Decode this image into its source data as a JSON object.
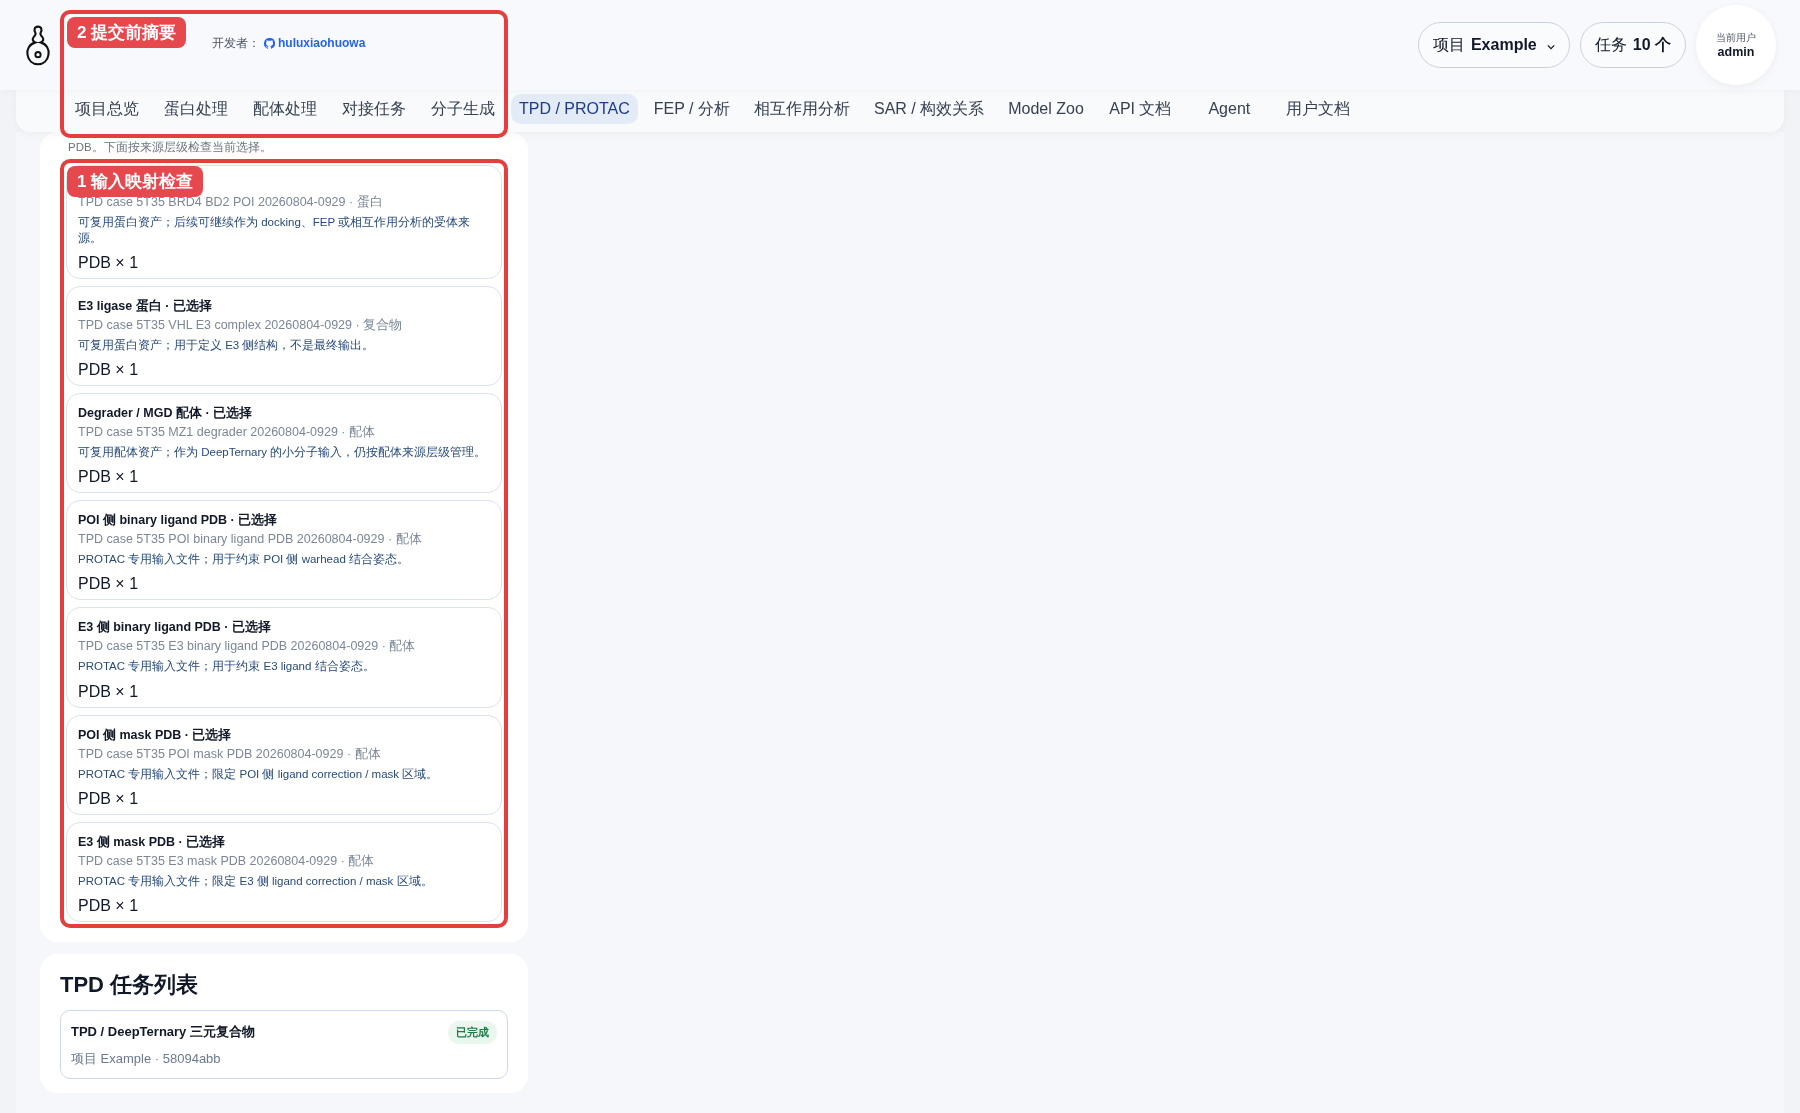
{
  "header": {
    "developer_label": "开发者：",
    "developer_link": "huluxiaohuowa",
    "project": {
      "label": "项目",
      "value": "Example"
    },
    "tasks": {
      "label": "任务",
      "value": "10 个"
    },
    "user": {
      "label": "当前用户",
      "name": "admin"
    }
  },
  "nav": [
    {
      "label": "项目总览",
      "selected": false
    },
    {
      "label": "蛋白处理",
      "selected": false
    },
    {
      "label": "配体处理",
      "selected": false
    },
    {
      "label": "对接任务",
      "selected": false
    },
    {
      "label": "分子生成",
      "selected": false
    },
    {
      "label": "TPD / PROTAC",
      "selected": true
    },
    {
      "label": "FEP / 分析",
      "selected": false
    },
    {
      "label": "相互作用分析",
      "selected": false
    },
    {
      "label": "SAR / 构效关系",
      "selected": false
    },
    {
      "label": "Model Zoo",
      "selected": false
    },
    {
      "label": "API 文档",
      "selected": false
    },
    {
      "label": "Agent",
      "selected": false
    },
    {
      "label": "用户文档",
      "selected": false
    }
  ],
  "intro": "PDB。下面按来源层级检查当前选择。",
  "annotations": [
    {
      "number": "2",
      "label": "提交前摘要"
    },
    {
      "number": "1",
      "label": "输入映射检查"
    }
  ],
  "inputs": [
    {
      "source": "TPD case 5T35 BRD4 BD2 POI 20260804-0929 · 蛋白",
      "note": "可复用蛋白资产；后续可继续作为 docking、FEP 或相互作用分析的受体来源。",
      "count": "PDB × 1"
    },
    {
      "title": "E3 ligase 蛋白 · 已选择",
      "source": "TPD case 5T35 VHL E3 complex 20260804-0929 · 复合物",
      "note": "可复用蛋白资产；用于定义 E3 侧结构，不是最终输出。",
      "count": "PDB × 1"
    },
    {
      "title": "Degrader / MGD 配体 · 已选择",
      "source": "TPD case 5T35 MZ1 degrader 20260804-0929 · 配体",
      "note": "可复用配体资产；作为 DeepTernary 的小分子输入，仍按配体来源层级管理。",
      "count": "PDB × 1"
    },
    {
      "title": "POI 侧 binary ligand PDB · 已选择",
      "source": "TPD case 5T35 POI binary ligand PDB 20260804-0929 · 配体",
      "note": "PROTAC 专用输入文件；用于约束 POI 侧 warhead 结合姿态。",
      "count": "PDB × 1"
    },
    {
      "title": "E3 侧 binary ligand PDB · 已选择",
      "source": "TPD case 5T35 E3 binary ligand PDB 20260804-0929 · 配体",
      "note": "PROTAC 专用输入文件；用于约束 E3 ligand 结合姿态。",
      "count": "PDB × 1"
    },
    {
      "title": "POI 侧 mask PDB · 已选择",
      "source": "TPD case 5T35 POI mask PDB 20260804-0929 · 配体",
      "note": "PROTAC 专用输入文件；限定 POI 侧 ligand correction / mask 区域。",
      "count": "PDB × 1"
    },
    {
      "title": "E3 侧 mask PDB · 已选择",
      "source": "TPD case 5T35 E3 mask PDB 20260804-0929 · 配体",
      "note": "PROTAC 专用输入文件；限定 E3 侧 ligand correction / mask 区域。",
      "count": "PDB × 1"
    }
  ],
  "task_list": {
    "title": "TPD 任务列表",
    "tasks": [
      {
        "name": "TPD / DeepTernary 三元复合物",
        "meta": "项目 Example · 58094abb",
        "status": "已完成",
        "kind": "done"
      }
    ]
  }
}
